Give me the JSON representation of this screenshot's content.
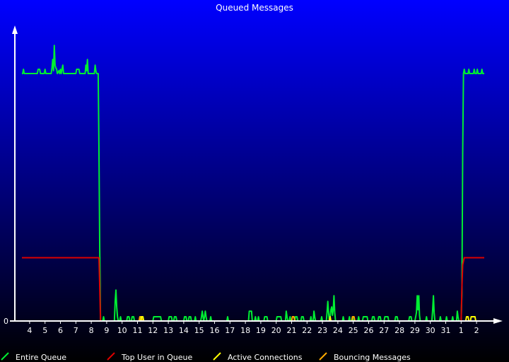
{
  "chart_data": {
    "type": "line",
    "title": "Queued Messages",
    "xlabel": "",
    "ylabel": "",
    "y_tick_labels": [
      "0"
    ],
    "x_tick_labels": [
      "4",
      "5",
      "6",
      "7",
      "8",
      "9",
      "10",
      "11",
      "12",
      "13",
      "14",
      "15",
      "16",
      "17",
      "18",
      "19",
      "20",
      "21",
      "22",
      "23",
      "24",
      "25",
      "26",
      "27",
      "28",
      "29",
      "30",
      "31",
      "1",
      "2"
    ],
    "x_range": [
      3.5,
      33.5
    ],
    "ylim": [
      0,
      100
    ],
    "grid": false,
    "legend_position": "bottom",
    "colors": {
      "bg_top": "#0000ff",
      "bg_bottom": "#000000",
      "axis": "#ffffff",
      "entire_queue": "#00ee33",
      "top_user": "#dd0000",
      "active_connections": "#ffff00",
      "bouncing_messages": "#ffaa00"
    },
    "series": [
      {
        "name": "Entire Queue",
        "color": "#00ee33",
        "points": [
          [
            3.5,
            88
          ],
          [
            3.55,
            88
          ],
          [
            3.6,
            89.5
          ],
          [
            3.65,
            88
          ],
          [
            4.5,
            88
          ],
          [
            4.55,
            89.5
          ],
          [
            4.65,
            89.5
          ],
          [
            4.7,
            88
          ],
          [
            4.95,
            88
          ],
          [
            5.0,
            89.5
          ],
          [
            5.05,
            88
          ],
          [
            5.4,
            88
          ],
          [
            5.45,
            90
          ],
          [
            5.5,
            93
          ],
          [
            5.55,
            89
          ],
          [
            5.6,
            98
          ],
          [
            5.65,
            91
          ],
          [
            5.7,
            90
          ],
          [
            5.75,
            89.5
          ],
          [
            5.8,
            88
          ],
          [
            5.9,
            89
          ],
          [
            5.95,
            88
          ],
          [
            6.0,
            89.5
          ],
          [
            6.05,
            88
          ],
          [
            6.1,
            89.5
          ],
          [
            6.15,
            91
          ],
          [
            6.2,
            88
          ],
          [
            7.0,
            88
          ],
          [
            7.05,
            89.5
          ],
          [
            7.2,
            89.5
          ],
          [
            7.25,
            88
          ],
          [
            7.6,
            88
          ],
          [
            7.65,
            91
          ],
          [
            7.7,
            89
          ],
          [
            7.75,
            93
          ],
          [
            7.8,
            88
          ],
          [
            8.2,
            88
          ],
          [
            8.25,
            91
          ],
          [
            8.3,
            89
          ],
          [
            8.35,
            88
          ],
          [
            8.45,
            88
          ],
          [
            8.5,
            60
          ],
          [
            8.55,
            25
          ],
          [
            8.6,
            0
          ],
          [
            8.75,
            0
          ],
          [
            8.8,
            1.5
          ],
          [
            8.85,
            0
          ],
          [
            9.5,
            0
          ],
          [
            9.55,
            7
          ],
          [
            9.6,
            11
          ],
          [
            9.65,
            5
          ],
          [
            9.7,
            1.5
          ],
          [
            9.75,
            0
          ],
          [
            9.85,
            0
          ],
          [
            9.9,
            1.5
          ],
          [
            9.95,
            0
          ],
          [
            10.3,
            0
          ],
          [
            10.35,
            1.5
          ],
          [
            10.45,
            1.5
          ],
          [
            10.5,
            0
          ],
          [
            10.6,
            0
          ],
          [
            10.65,
            1.5
          ],
          [
            10.75,
            1.5
          ],
          [
            10.8,
            0
          ],
          [
            11.2,
            0
          ],
          [
            11.25,
            1.5
          ],
          [
            11.35,
            1.5
          ],
          [
            11.4,
            0
          ],
          [
            12.0,
            0
          ],
          [
            12.05,
            1.5
          ],
          [
            12.5,
            1.5
          ],
          [
            12.55,
            0
          ],
          [
            13.0,
            0
          ],
          [
            13.05,
            1.5
          ],
          [
            13.2,
            1.5
          ],
          [
            13.25,
            0
          ],
          [
            13.35,
            0
          ],
          [
            13.4,
            1.5
          ],
          [
            13.5,
            1.5
          ],
          [
            13.55,
            0
          ],
          [
            14.0,
            0
          ],
          [
            14.05,
            1.5
          ],
          [
            14.15,
            1.5
          ],
          [
            14.2,
            0
          ],
          [
            14.3,
            0
          ],
          [
            14.35,
            1.5
          ],
          [
            14.45,
            1.5
          ],
          [
            14.5,
            0
          ],
          [
            14.7,
            0
          ],
          [
            14.75,
            1.5
          ],
          [
            14.8,
            0
          ],
          [
            15.1,
            0
          ],
          [
            15.15,
            1.5
          ],
          [
            15.2,
            3.5
          ],
          [
            15.25,
            1.5
          ],
          [
            15.3,
            0
          ],
          [
            15.35,
            1.5
          ],
          [
            15.4,
            3.5
          ],
          [
            15.45,
            1.5
          ],
          [
            15.5,
            0
          ],
          [
            15.7,
            0
          ],
          [
            15.75,
            1.5
          ],
          [
            15.8,
            0
          ],
          [
            16.8,
            0
          ],
          [
            16.85,
            1.5
          ],
          [
            16.9,
            0
          ],
          [
            18.2,
            0
          ],
          [
            18.25,
            3.5
          ],
          [
            18.4,
            3.5
          ],
          [
            18.45,
            0
          ],
          [
            18.6,
            0
          ],
          [
            18.65,
            1.5
          ],
          [
            18.7,
            0
          ],
          [
            18.8,
            0
          ],
          [
            18.85,
            1.5
          ],
          [
            18.9,
            0
          ],
          [
            19.2,
            0
          ],
          [
            19.25,
            1.5
          ],
          [
            19.4,
            1.5
          ],
          [
            19.45,
            0
          ],
          [
            20.0,
            0
          ],
          [
            20.05,
            1.5
          ],
          [
            20.3,
            1.5
          ],
          [
            20.35,
            0
          ],
          [
            20.6,
            0
          ],
          [
            20.65,
            3.5
          ],
          [
            20.7,
            1.5
          ],
          [
            20.75,
            0
          ],
          [
            20.85,
            0
          ],
          [
            20.9,
            1.5
          ],
          [
            20.95,
            0
          ],
          [
            21.2,
            0
          ],
          [
            21.25,
            1.5
          ],
          [
            21.35,
            1.5
          ],
          [
            21.4,
            0
          ],
          [
            21.6,
            0
          ],
          [
            21.65,
            1.5
          ],
          [
            21.75,
            1.5
          ],
          [
            21.8,
            0
          ],
          [
            22.2,
            0
          ],
          [
            22.25,
            1.5
          ],
          [
            22.3,
            0
          ],
          [
            22.4,
            0
          ],
          [
            22.45,
            3.5
          ],
          [
            22.5,
            1.5
          ],
          [
            22.55,
            0
          ],
          [
            22.9,
            0
          ],
          [
            22.95,
            1.5
          ],
          [
            23.0,
            0
          ],
          [
            23.25,
            0
          ],
          [
            23.3,
            3
          ],
          [
            23.35,
            7
          ],
          [
            23.4,
            3
          ],
          [
            23.45,
            0
          ],
          [
            23.5,
            1.5
          ],
          [
            23.55,
            4
          ],
          [
            23.6,
            5
          ],
          [
            23.65,
            2
          ],
          [
            23.7,
            4
          ],
          [
            23.75,
            9
          ],
          [
            23.8,
            3
          ],
          [
            23.85,
            0
          ],
          [
            24.3,
            0
          ],
          [
            24.35,
            1.5
          ],
          [
            24.4,
            0
          ],
          [
            24.7,
            0
          ],
          [
            24.75,
            1.5
          ],
          [
            24.8,
            0
          ],
          [
            24.9,
            0
          ],
          [
            24.95,
            1.5
          ],
          [
            25.0,
            0
          ],
          [
            25.3,
            0
          ],
          [
            25.35,
            1.5
          ],
          [
            25.4,
            0
          ],
          [
            25.6,
            0
          ],
          [
            25.65,
            1.5
          ],
          [
            25.9,
            1.5
          ],
          [
            25.95,
            0
          ],
          [
            26.2,
            0
          ],
          [
            26.25,
            1.5
          ],
          [
            26.35,
            1.5
          ],
          [
            26.4,
            0
          ],
          [
            26.6,
            0
          ],
          [
            26.65,
            1.5
          ],
          [
            26.75,
            1.5
          ],
          [
            26.8,
            0
          ],
          [
            27.0,
            0
          ],
          [
            27.05,
            1.5
          ],
          [
            27.25,
            1.5
          ],
          [
            27.3,
            0
          ],
          [
            27.7,
            0
          ],
          [
            27.75,
            1.5
          ],
          [
            27.85,
            1.5
          ],
          [
            27.9,
            0
          ],
          [
            28.6,
            0
          ],
          [
            28.65,
            1.5
          ],
          [
            28.75,
            1.5
          ],
          [
            28.8,
            0
          ],
          [
            29.0,
            0
          ],
          [
            29.05,
            1.5
          ],
          [
            29.1,
            3
          ],
          [
            29.15,
            9
          ],
          [
            29.2,
            4
          ],
          [
            29.25,
            9
          ],
          [
            29.3,
            2
          ],
          [
            29.35,
            0
          ],
          [
            29.7,
            0
          ],
          [
            29.75,
            1.5
          ],
          [
            29.8,
            0
          ],
          [
            30.1,
            0
          ],
          [
            30.15,
            4
          ],
          [
            30.2,
            9
          ],
          [
            30.25,
            3
          ],
          [
            30.3,
            0
          ],
          [
            30.6,
            0
          ],
          [
            30.65,
            1.5
          ],
          [
            30.7,
            0
          ],
          [
            31.0,
            0
          ],
          [
            31.05,
            1.5
          ],
          [
            31.1,
            0
          ],
          [
            31.4,
            0
          ],
          [
            31.45,
            1.5
          ],
          [
            31.5,
            0
          ],
          [
            31.7,
            0
          ],
          [
            31.75,
            3.5
          ],
          [
            31.8,
            1.5
          ],
          [
            31.85,
            0
          ],
          [
            32.0,
            0
          ],
          [
            32.05,
            10
          ],
          [
            32.1,
            60
          ],
          [
            32.15,
            88
          ],
          [
            32.2,
            89.5
          ],
          [
            32.25,
            88
          ],
          [
            32.45,
            88
          ],
          [
            32.5,
            89.5
          ],
          [
            32.55,
            88
          ],
          [
            32.8,
            88
          ],
          [
            32.85,
            89.5
          ],
          [
            32.9,
            88
          ],
          [
            33.0,
            88
          ],
          [
            33.05,
            89.5
          ],
          [
            33.1,
            88
          ],
          [
            33.3,
            88
          ],
          [
            33.35,
            89.5
          ],
          [
            33.4,
            88
          ],
          [
            33.5,
            88
          ]
        ]
      },
      {
        "name": "Top User in Queue",
        "color": "#dd0000",
        "points": [
          [
            3.5,
            22.5
          ],
          [
            8.5,
            22.5
          ],
          [
            8.55,
            12
          ],
          [
            8.6,
            0
          ],
          [
            32.0,
            0
          ],
          [
            32.05,
            12
          ],
          [
            32.1,
            20
          ],
          [
            32.2,
            22.5
          ],
          [
            33.5,
            22.5
          ]
        ]
      },
      {
        "name": "Active Connections",
        "color": "#ffff00",
        "points": [
          [
            3.5,
            0
          ],
          [
            8.6,
            0
          ],
          [
            8.62,
            0
          ],
          [
            11.2,
            0
          ],
          [
            11.25,
            1.5
          ],
          [
            11.35,
            1.5
          ],
          [
            11.4,
            0
          ],
          [
            23.45,
            0
          ],
          [
            23.5,
            1.5
          ],
          [
            23.55,
            0
          ],
          [
            32.3,
            0
          ],
          [
            32.35,
            1.5
          ],
          [
            32.45,
            1.5
          ],
          [
            32.5,
            0
          ],
          [
            32.6,
            0
          ],
          [
            32.65,
            1.5
          ],
          [
            32.9,
            1.5
          ],
          [
            32.95,
            0
          ],
          [
            33.5,
            0
          ]
        ]
      },
      {
        "name": "Bouncing Messages",
        "color": "#ffaa00",
        "points": [
          [
            3.5,
            0
          ],
          [
            11.1,
            0
          ],
          [
            11.15,
            1.5
          ],
          [
            11.25,
            1.5
          ],
          [
            11.3,
            0
          ],
          [
            21.0,
            0
          ],
          [
            21.05,
            1.5
          ],
          [
            21.15,
            1.5
          ],
          [
            21.2,
            0
          ],
          [
            24.9,
            0
          ],
          [
            24.95,
            1.5
          ],
          [
            25.05,
            1.5
          ],
          [
            25.1,
            0
          ],
          [
            33.5,
            0
          ]
        ]
      }
    ]
  }
}
